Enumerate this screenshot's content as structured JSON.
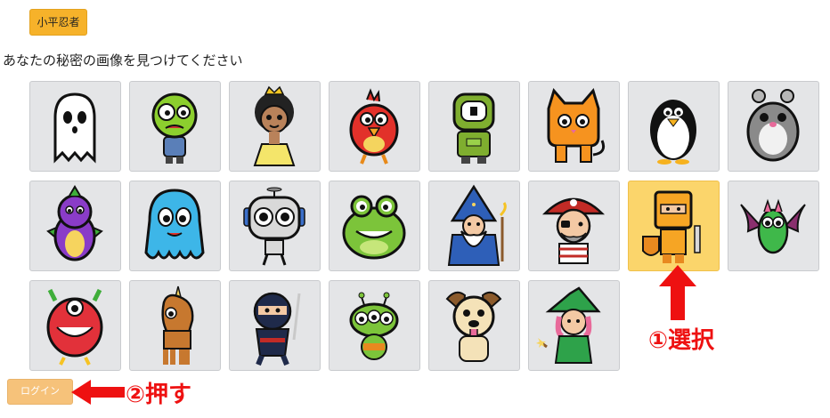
{
  "user": {
    "name": "小平忍者"
  },
  "prompt": "あなたの秘密の画像を見つけてください",
  "tiles": [
    {
      "icon": "ghost-icon"
    },
    {
      "icon": "zombie-icon"
    },
    {
      "icon": "princess-icon"
    },
    {
      "icon": "red-bird-icon"
    },
    {
      "icon": "robot-icon"
    },
    {
      "icon": "cat-icon"
    },
    {
      "icon": "penguin-icon"
    },
    {
      "icon": "hamster-icon"
    },
    {
      "icon": "purple-dragon-icon"
    },
    {
      "icon": "octopus-icon"
    },
    {
      "icon": "grey-robot-icon"
    },
    {
      "icon": "frog-icon"
    },
    {
      "icon": "wizard-icon"
    },
    {
      "icon": "pirate-icon"
    },
    {
      "icon": "knight-icon",
      "selected": true
    },
    {
      "icon": "bat-icon"
    },
    {
      "icon": "monster-icon"
    },
    {
      "icon": "unicorn-icon"
    },
    {
      "icon": "ninja-icon"
    },
    {
      "icon": "alien-icon"
    },
    {
      "icon": "dog-icon"
    },
    {
      "icon": "witch-icon"
    }
  ],
  "login_button": {
    "label": "ログイン"
  },
  "annotations": {
    "select": "①選択",
    "press": "②押す",
    "color": "#ee1111"
  },
  "colors": {
    "badge": "#f6b22a",
    "tile_bg": "#e4e5e7",
    "tile_selected": "#fbd56b",
    "login_bg": "#f6c27a"
  }
}
